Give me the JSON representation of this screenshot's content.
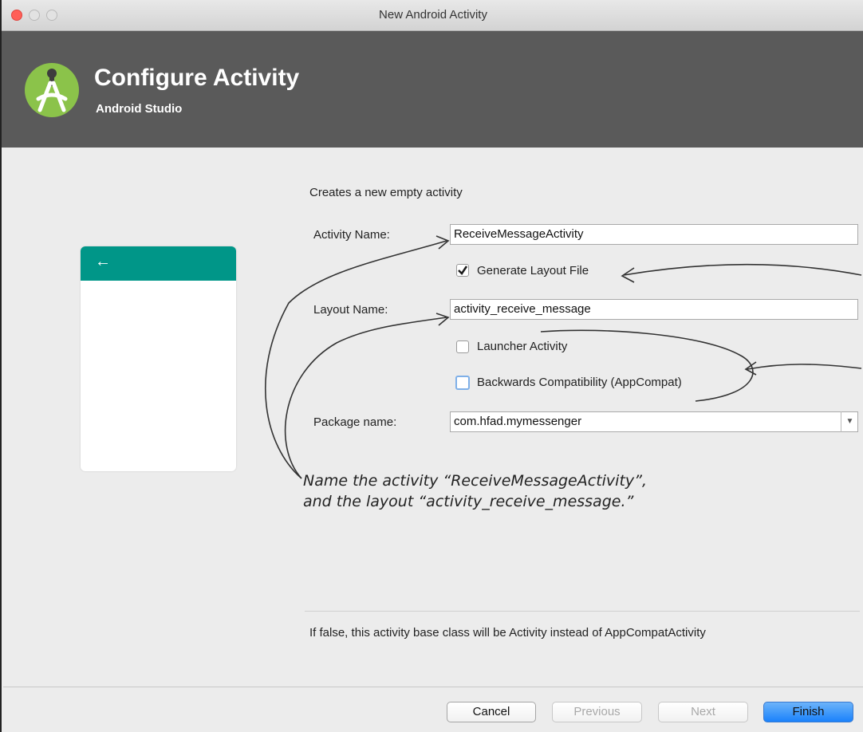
{
  "window": {
    "title": "New Android Activity"
  },
  "banner": {
    "title": "Configure Activity",
    "subtitle": "Android Studio"
  },
  "form": {
    "description": "Creates a new empty activity",
    "activity_name_label": "Activity Name:",
    "activity_name_value": "ReceiveMessageActivity",
    "generate_layout_label": "Generate Layout File",
    "generate_layout_checked": true,
    "layout_name_label": "Layout Name:",
    "layout_name_value": "activity_receive_message",
    "launcher_label": "Launcher Activity",
    "launcher_checked": false,
    "backwards_label": "Backwards Compatibility (AppCompat)",
    "backwards_checked": false,
    "package_label": "Package name:",
    "package_value": "com.hfad.mymessenger"
  },
  "hint": "If false, this activity base class will be Activity instead of AppCompatActivity",
  "annotation": {
    "line1": "Name the activity “ReceiveMessageActivity”,",
    "line2": "and the layout “activity_receive_message.”"
  },
  "buttons": {
    "cancel": "Cancel",
    "previous": "Previous",
    "next": "Next",
    "finish": "Finish"
  },
  "colors": {
    "banner": "#5a5a5a",
    "preview_bar": "#009688",
    "finish": "#1a82fb",
    "logo": "#8bc34a"
  }
}
